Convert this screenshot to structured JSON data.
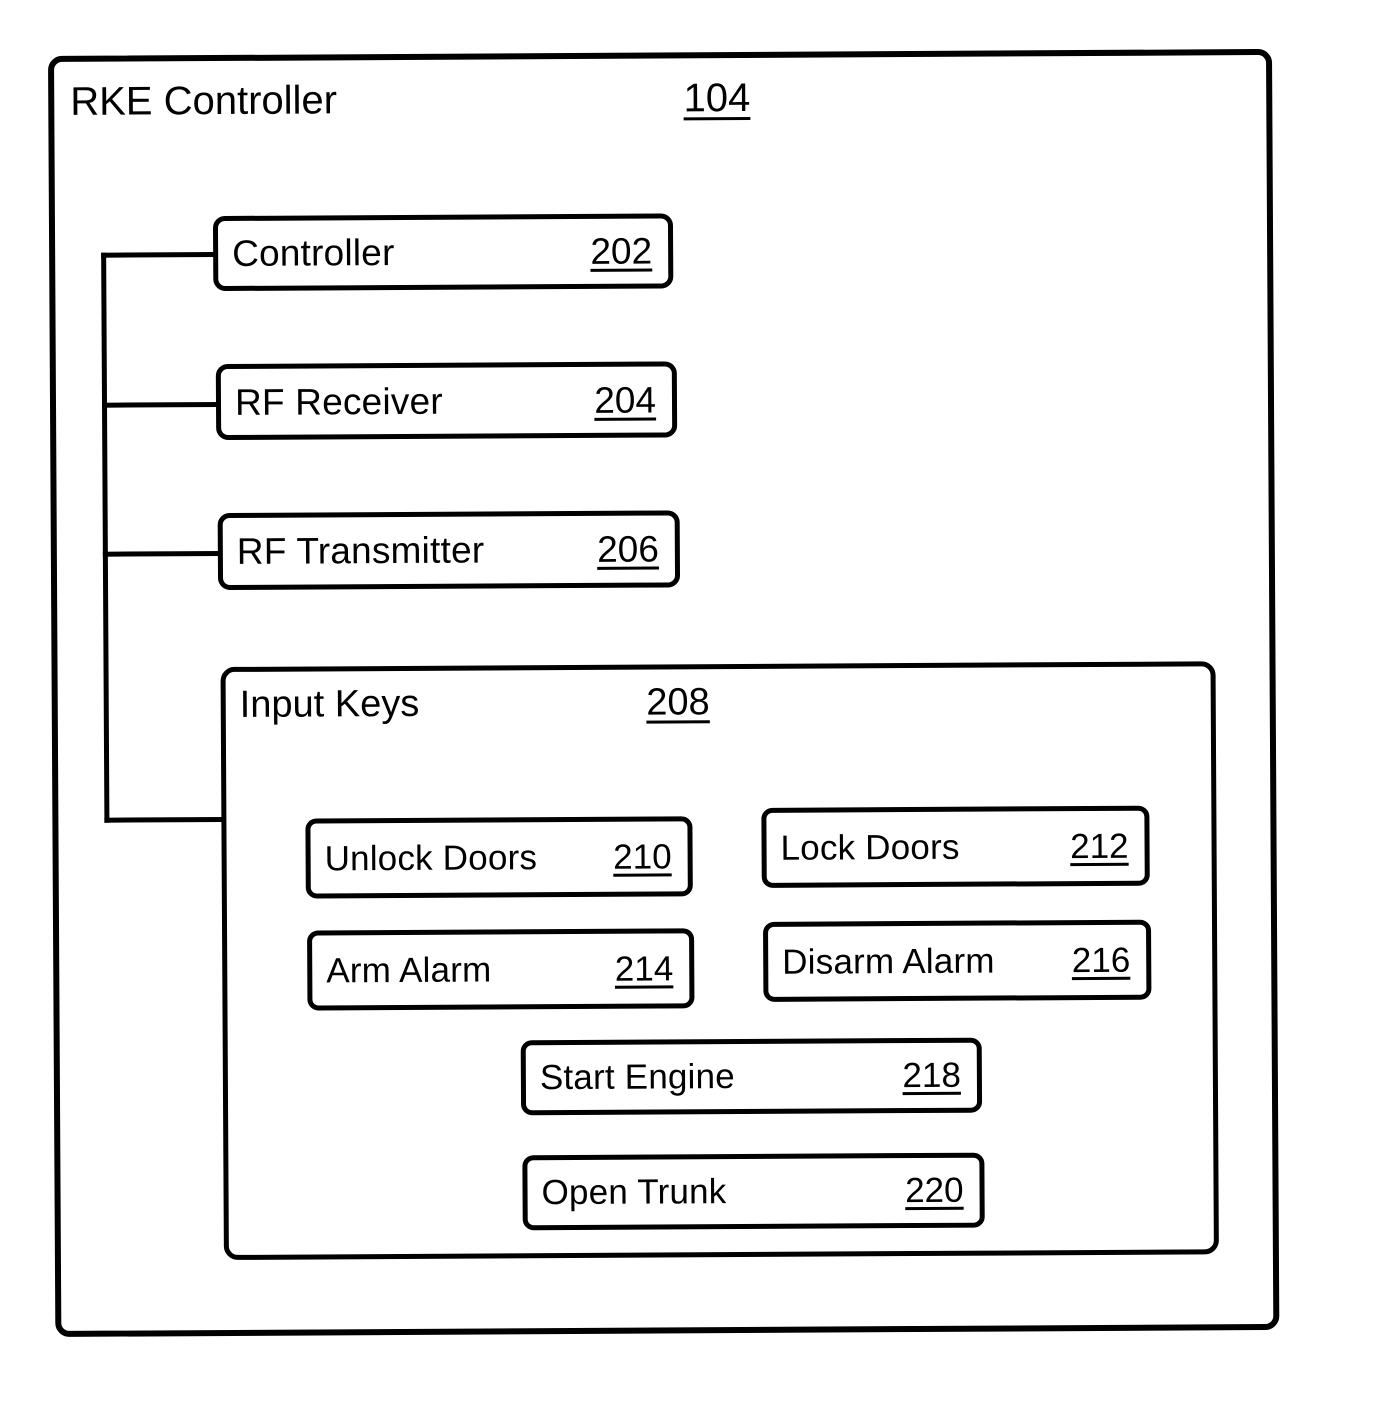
{
  "figure": {
    "outer": {
      "title": "RKE Controller",
      "ref": "104"
    },
    "components": [
      {
        "name": "controller",
        "label": "Controller",
        "ref": "202"
      },
      {
        "name": "rf-receiver",
        "label": "RF Receiver",
        "ref": "204"
      },
      {
        "name": "rf-transmitter",
        "label": "RF Transmitter",
        "ref": "206"
      }
    ],
    "input_keys": {
      "title": "Input Keys",
      "ref": "208",
      "keys": [
        {
          "name": "unlock-doors",
          "label": "Unlock Doors",
          "ref": "210"
        },
        {
          "name": "lock-doors",
          "label": "Lock Doors",
          "ref": "212"
        },
        {
          "name": "arm-alarm",
          "label": "Arm Alarm",
          "ref": "214"
        },
        {
          "name": "disarm-alarm",
          "label": "Disarm Alarm",
          "ref": "216"
        },
        {
          "name": "start-engine",
          "label": "Start Engine",
          "ref": "218"
        },
        {
          "name": "open-trunk",
          "label": "Open Trunk",
          "ref": "220"
        }
      ]
    },
    "colors": {
      "line": "#000000",
      "background": "#ffffff"
    }
  }
}
